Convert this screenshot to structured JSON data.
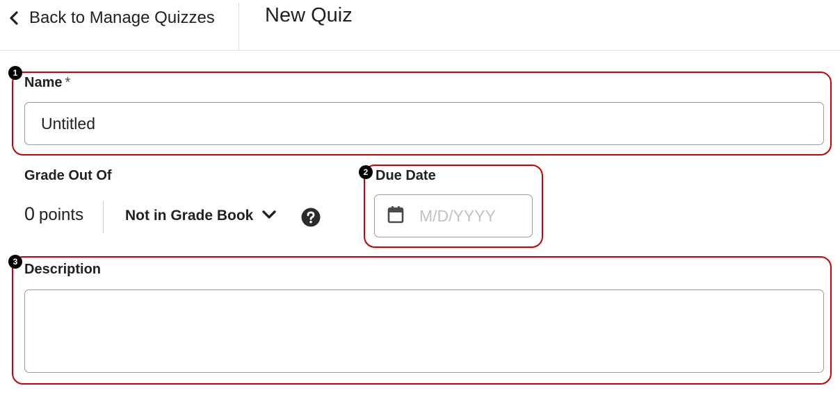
{
  "header": {
    "back_label": "Back to Manage Quizzes",
    "page_title": "New Quiz"
  },
  "callouts": {
    "one": "1",
    "two": "2",
    "three": "3",
    "color": "#cc0000"
  },
  "name_field": {
    "label": "Name",
    "required_marker": "*",
    "value": "Untitled"
  },
  "grade": {
    "label": "Grade Out Of",
    "points_value": "0",
    "points_unit": "points",
    "gradebook_label": "Not in Grade Book"
  },
  "due_date": {
    "label": "Due Date",
    "placeholder": "M/D/YYYY"
  },
  "description": {
    "label": "Description",
    "value": ""
  },
  "icons": {
    "back": "chevron-left-icon",
    "gradebook_dropdown": "chevron-down-icon",
    "help": "help-icon",
    "calendar": "calendar-icon"
  }
}
